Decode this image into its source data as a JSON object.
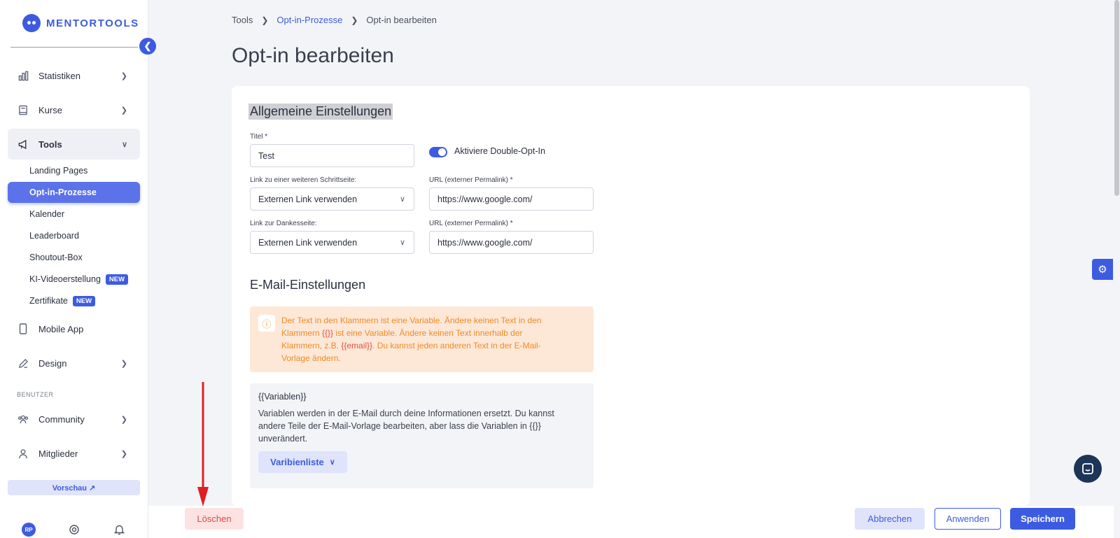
{
  "sidebar": {
    "logo_text": "MENTORTOOLS",
    "items": [
      {
        "label": "Statistiken",
        "icon": "bar-chart-icon"
      },
      {
        "label": "Kurse",
        "icon": "book-icon"
      },
      {
        "label": "Tools",
        "icon": "megaphone-icon"
      }
    ],
    "sub_items": [
      {
        "label": "Landing Pages"
      },
      {
        "label": "Opt-in-Prozesse"
      },
      {
        "label": "Kalender"
      },
      {
        "label": "Leaderboard"
      },
      {
        "label": "Shoutout-Box"
      },
      {
        "label": "KI-Videoerstellung",
        "badge": "NEW"
      },
      {
        "label": "Zertifikate",
        "badge": "NEW"
      }
    ],
    "mobile_app": "Mobile App",
    "design": "Design",
    "section_label": "BENUTZER",
    "community": "Community",
    "members": "Mitglieder",
    "preview_label": "Vorschau ↗",
    "avatar_initials": "RP"
  },
  "breadcrumb": {
    "root": "Tools",
    "parent": "Opt-in-Prozesse",
    "current": "Opt-in bearbeiten"
  },
  "page_title": "Opt-in bearbeiten",
  "general": {
    "title": "Allgemeine Einstellungen",
    "title_label": "Titel *",
    "title_value": "Test",
    "double_optin_label": "Aktiviere Double-Opt-In",
    "double_optin_enabled": true,
    "step_link_label": "Link zu einer weiteren Schrittseite:",
    "step_link_value": "Externen Link verwenden",
    "url_label_1": "URL (externer Permalink) *",
    "url_value_1": "https://www.google.com/",
    "thanks_link_label": "Link zur Dankesseite:",
    "thanks_link_value": "Externen Link verwenden",
    "url_label_2": "URL (externer Permalink) *",
    "url_value_2": "https://www.google.com/"
  },
  "email": {
    "title": "E-Mail-Einstellungen",
    "alert_part1": "Der Text in den Klammern ist eine Variable. Ändere keinen Text in den Klammern ",
    "alert_var1": "{{}}",
    "alert_part2": " ist eine Variable. Ändere keinen Text innerhalb der Klammern, z.B. ",
    "alert_var2": "{{email}}",
    "alert_part3": ". Du kannst jeden anderen Text in der E-Mail-Vorlage ändern.",
    "var_title": "{{Variablen}}",
    "var_text": "Variablen werden in der E-Mail durch deine Informationen ersetzt. Du kannst andere Teile der E-Mail-Vorlage bearbeiten, aber lass die Variablen in {{}} unverändert.",
    "var_button": "Varibienliste"
  },
  "actions": {
    "delete": "Löschen",
    "cancel": "Abbrechen",
    "apply": "Anwenden",
    "save": "Speichern"
  },
  "colors": {
    "accent": "#3d5be0",
    "warning_bg": "#fde8d8",
    "warning_text": "#f08a24",
    "danger": "#e0464a",
    "annotation_arrow": "#e02020"
  }
}
